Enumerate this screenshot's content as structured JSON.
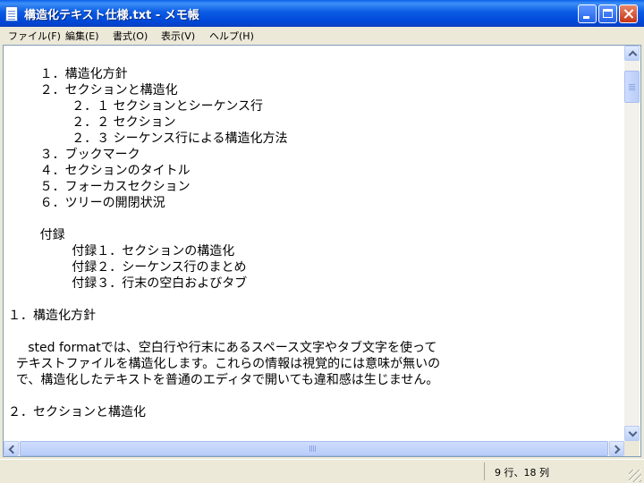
{
  "window": {
    "title": "構造化テキスト仕様.txt - メモ帳"
  },
  "menu": [
    "ファイル(F)",
    "編集(E)",
    "書式(O)",
    "表示(V)",
    "ヘルプ(H)"
  ],
  "document_lines": [
    "",
    "        １．構造化方針",
    "        ２．セクションと構造化",
    "                ２．１ セクションとシーケンス行",
    "                ２．２ セクション",
    "                ２．３ シーケンス行による構造化方法",
    "        ３．ブックマーク",
    "        ４．セクションのタイトル",
    "        ５．フォーカスセクション",
    "        ６．ツリーの開閉状況",
    "",
    "        付録",
    "                付録１．セクションの構造化",
    "                付録２．シーケンス行のまとめ",
    "                付録３．行末の空白およびタブ",
    "",
    "１．構造化方針",
    "",
    "     sted formatでは、空白行や行末にあるスペース文字やタブ文字を使って",
    "  テキストファイルを構造化します。これらの情報は視覚的には意味が無いの",
    "  で、構造化したテキストを普通のエディタで開いても違和感は生じません。",
    "",
    "２．セクションと構造化"
  ],
  "status": {
    "position": "9 行、18 列"
  }
}
